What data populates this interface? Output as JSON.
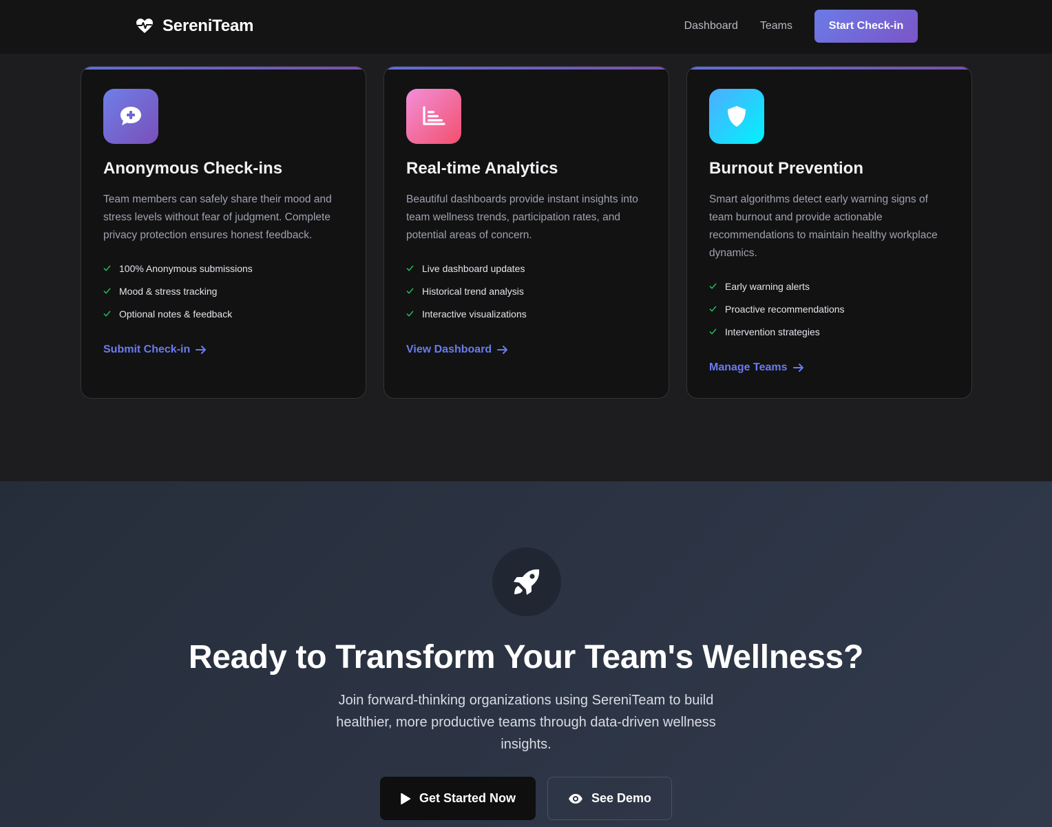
{
  "navbar": {
    "brand": "SereniTeam",
    "brand_icon": "heartbeat-icon",
    "links": [
      "Dashboard",
      "Teams"
    ],
    "cta": "Start Check-in"
  },
  "features": [
    {
      "icon": "comment-medical-icon",
      "icon_gradient": [
        "#6f7fe8",
        "#7a4fb8"
      ],
      "title": "Anonymous Check-ins",
      "description": "Team members can safely share their mood and stress levels without fear of judgment. Complete privacy protection ensures honest feedback.",
      "items": [
        "100% Anonymous submissions",
        "Mood & stress tracking",
        "Optional notes & feedback"
      ],
      "link": "Submit Check-in"
    },
    {
      "icon": "chart-bar-icon",
      "icon_gradient": [
        "#f28fd8",
        "#f2506e"
      ],
      "title": "Real-time Analytics",
      "description": "Beautiful dashboards provide instant insights into team wellness trends, participation rates, and potential areas of concern.",
      "items": [
        "Live dashboard updates",
        "Historical trend analysis",
        "Interactive visualizations"
      ],
      "link": "View Dashboard"
    },
    {
      "icon": "shield-icon",
      "icon_gradient": [
        "#4facfe",
        "#00f2fe"
      ],
      "title": "Burnout Prevention",
      "description": "Smart algorithms detect early warning signs of team burnout and provide actionable recommendations to maintain healthy workplace dynamics.",
      "items": [
        "Early warning alerts",
        "Proactive recommendations",
        "Intervention strategies"
      ],
      "link": "Manage Teams"
    }
  ],
  "cta": {
    "icon": "rocket-icon",
    "title": "Ready to Transform Your Team's Wellness?",
    "text": "Join forward-thinking organizations using SereniTeam to build healthier, more productive teams through data-driven wellness insights.",
    "primary_button": "Get Started Now",
    "secondary_button": "See Demo"
  },
  "colors": {
    "accent": "#6a7cf0",
    "check": "#22c55e",
    "background": "#1d1d1f",
    "card": "#121213"
  }
}
